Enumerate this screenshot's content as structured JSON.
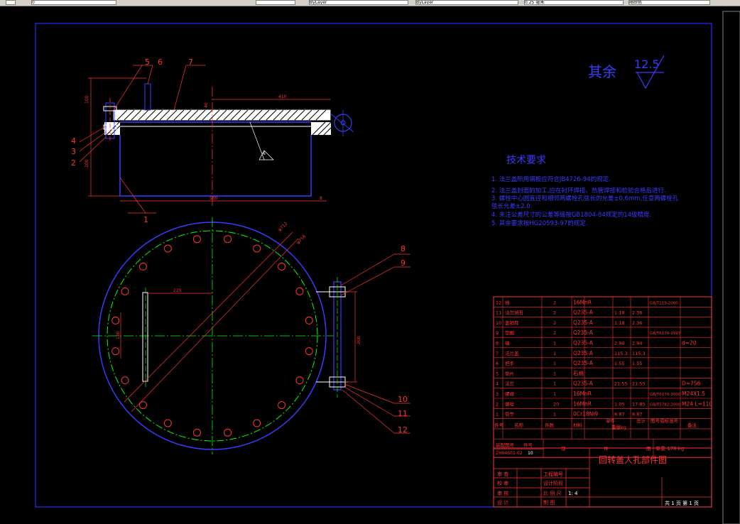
{
  "toolbar": {
    "layer_combo": "0",
    "color_combo": "ByLayer",
    "linetype_combo": "ByLayer",
    "lineweight_combo": "0.25 毫米",
    "plotstyle_combo": "随颜色"
  },
  "roughness": {
    "label": "其余",
    "value": "12.5"
  },
  "tech_req": {
    "title": "技术要求",
    "items": [
      "1. 法兰盖所用钢板应符合JB4726-94的规定.",
      "2. 法兰盖封面的加工,应在衬环焊接、热管焊接和检验合格后进行.",
      "3. 螺栓中心圆直径和相邻两螺栓孔弦长的允差±0.6mm,任意两螺栓孔",
      "   弦长允差±2.0.",
      "4. 未注公差尺寸的公差等级按GB1804-84规定的14级精度.",
      "5. 其余要求按HG20593-97的规定."
    ]
  },
  "dims": {
    "d100": "100",
    "d410": "410",
    "d550": "550",
    "d8": "8",
    "d200": "200",
    "d225": "225",
    "d300": "300",
    "d120": "120",
    "d40": "40",
    "phi712": "φ712",
    "phi756": "φ756",
    "weld": "6"
  },
  "callouts": [
    "1",
    "2",
    "3",
    "4",
    "5",
    "6",
    "7",
    "8",
    "9",
    "10",
    "11",
    "12"
  ],
  "bom": {
    "rows": [
      {
        "no": "12",
        "name": "销",
        "qty": "2",
        "mat": "16MnR",
        "w1": "",
        "w2": "",
        "std": "GB/T119-2000",
        "note": ""
      },
      {
        "no": "11",
        "name": "法兰销耳",
        "qty": "2",
        "mat": "Q235-A",
        "w1": "1.18",
        "w2": "2.36",
        "std": "",
        "note": ""
      },
      {
        "no": "10",
        "name": "盖销耳",
        "qty": "2",
        "mat": "Q235-A",
        "w1": "1.18",
        "w2": "2.36",
        "std": "",
        "note": ""
      },
      {
        "no": "9",
        "name": "垫圈",
        "qty": "2",
        "mat": "Q235-A",
        "w1": "",
        "w2": "",
        "std": "GB/T6170-1997",
        "note": ""
      },
      {
        "no": "8",
        "name": "轴",
        "qty": "1",
        "mat": "Q235-A",
        "w1": "2.94",
        "w2": "2.94",
        "std": "",
        "note": "d=20"
      },
      {
        "no": "7",
        "name": "法兰盖",
        "qty": "1",
        "mat": "Q235-A",
        "w1": "115.3",
        "w2": "115.3",
        "std": "",
        "note": ""
      },
      {
        "no": "6",
        "name": "把手",
        "qty": "1",
        "mat": "Q235-A",
        "w1": "1.55",
        "w2": "1.55",
        "std": "",
        "note": ""
      },
      {
        "no": "5",
        "name": "垫片",
        "qty": "1",
        "mat": "石棉",
        "w1": "",
        "w2": "",
        "std": "",
        "note": ""
      },
      {
        "no": "4",
        "name": "法兰",
        "qty": "1",
        "mat": "Q235-A",
        "w1": "21.55",
        "w2": "21.55",
        "std": "",
        "note": "D=756"
      },
      {
        "no": "3",
        "name": "螺母",
        "qty": "1",
        "mat": "16MnR",
        "w1": "",
        "w2": "",
        "std": "GB/T6170-2000",
        "note": "M24X1.5"
      },
      {
        "no": "2",
        "name": "螺栓",
        "qty": "20",
        "mat": "16MnR",
        "w1": "1.05",
        "w2": "17.85",
        "std": "GB/T5782-2000",
        "note": "M24 L=110"
      },
      {
        "no": "1",
        "name": "筒节",
        "qty": "1",
        "mat": "0Cr18Ni9",
        "w1": "8.87",
        "w2": "8.87",
        "std": "",
        "note": ""
      }
    ],
    "header": {
      "no": "件号",
      "name": "名称",
      "qty": "件数",
      "mat": "材料",
      "w_single": "单件",
      "w_total": "总计",
      "w_label": "重量kg",
      "std": "图号或标准号",
      "note": "备注"
    },
    "drawing_no_label": "装配图号",
    "part_no_label": "件号",
    "drawing_no": "ZH04S01-02",
    "part_no": "10",
    "spec_cells": [
      "部",
      "件",
      "图"
    ],
    "weight": "单重 178 kg"
  },
  "title_block": {
    "title": "回转盖人孔部件图",
    "rows": [
      [
        "审 查",
        "",
        "工程编号",
        ""
      ],
      [
        "校 审",
        "",
        "设计阶段",
        ""
      ],
      [
        "审 核",
        "",
        "比 例 尺",
        "1: 4"
      ],
      [
        "设 计",
        "",
        "制 图",
        ""
      ]
    ],
    "sheets": "共 1 页   第 1 页"
  }
}
